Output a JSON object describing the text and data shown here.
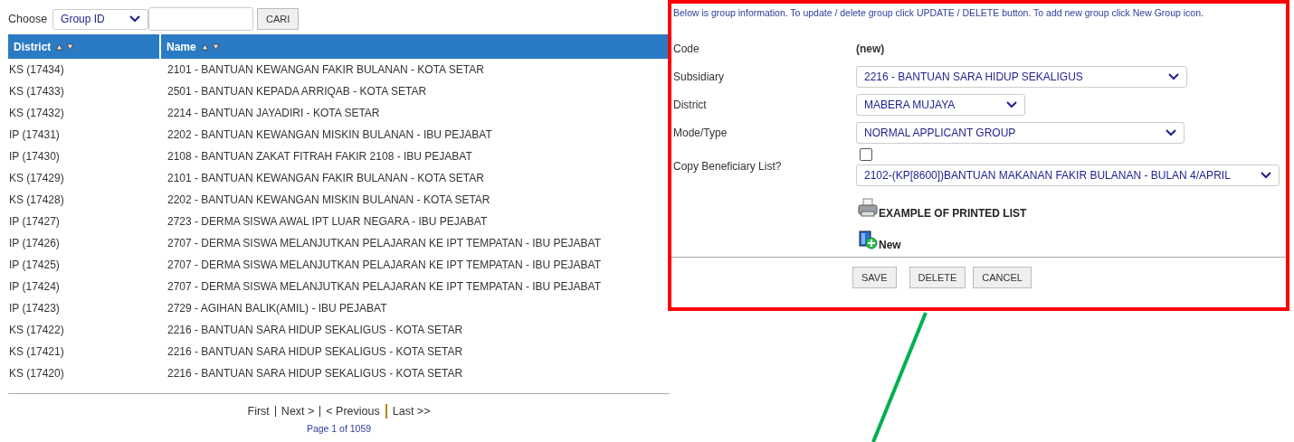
{
  "search": {
    "label": "Choose",
    "field": "Group ID",
    "button": "CARI"
  },
  "table": {
    "columns": [
      "District",
      "Name"
    ],
    "rows": [
      [
        "KS (17434)",
        "2101 - BANTUAN KEWANGAN FAKIR BULANAN - KOTA SETAR"
      ],
      [
        "KS (17433)",
        "2501 - BANTUAN KEPADA ARRIQAB - KOTA SETAR"
      ],
      [
        "KS (17432)",
        "2214 - BANTUAN JAYADIRI - KOTA SETAR"
      ],
      [
        "IP (17431)",
        "2202 - BANTUAN KEWANGAN MISKIN BULANAN - IBU PEJABAT"
      ],
      [
        "IP (17430)",
        "2108 - BANTUAN ZAKAT FITRAH FAKIR 2108 - IBU PEJABAT"
      ],
      [
        "KS (17429)",
        "2101 - BANTUAN KEWANGAN FAKIR BULANAN - KOTA SETAR"
      ],
      [
        "KS (17428)",
        "2202 - BANTUAN KEWANGAN MISKIN BULANAN - KOTA SETAR"
      ],
      [
        "IP (17427)",
        "2723 - DERMA SISWA AWAL IPT LUAR NEGARA - IBU PEJABAT"
      ],
      [
        "IP (17426)",
        "2707 - DERMA SISWA MELANJUTKAN PELAJARAN KE IPT TEMPATAN - IBU PEJABAT"
      ],
      [
        "IP (17425)",
        "2707 - DERMA SISWA MELANJUTKAN PELAJARAN KE IPT TEMPATAN - IBU PEJABAT"
      ],
      [
        "IP (17424)",
        "2707 - DERMA SISWA MELANJUTKAN PELAJARAN KE IPT TEMPATAN - IBU PEJABAT"
      ],
      [
        "IP (17423)",
        "2729 - AGIHAN BALIK(AMIL) - IBU PEJABAT"
      ],
      [
        "KS (17422)",
        "2216 - BANTUAN SARA HIDUP SEKALIGUS - KOTA SETAR"
      ],
      [
        "KS (17421)",
        "2216 - BANTUAN SARA HIDUP SEKALIGUS - KOTA SETAR"
      ],
      [
        "KS (17420)",
        "2216 - BANTUAN SARA HIDUP SEKALIGUS - KOTA SETAR"
      ]
    ]
  },
  "pager": {
    "links": [
      "First",
      "Next >",
      "< Previous",
      "Last >>"
    ],
    "info": "Page 1 of 1059"
  },
  "panel": {
    "intro": "Below is group information. To update / delete group click UPDATE / DELETE button. To add new group click New Group icon.",
    "fields": [
      {
        "label": "Code",
        "kind": "text",
        "value": "(new)"
      },
      {
        "label": "Subsidiary",
        "kind": "select",
        "value": "2216 - BANTUAN SARA HIDUP SEKALIGUS"
      },
      {
        "label": "District",
        "kind": "select",
        "value": "MABERA MUJAYA"
      },
      {
        "label": "Mode/Type",
        "kind": "select",
        "value": "NORMAL APPLICANT GROUP"
      },
      {
        "label": "Copy Beneficiary List?",
        "kind": "checkbox-select",
        "checked": false,
        "value": "2102-(KP[8600])BANTUAN MAKANAN FAKIR BULANAN - BULAN 4/APRIL"
      }
    ],
    "actions": [
      {
        "kind": "print",
        "label": "EXAMPLE OF PRINTED LIST"
      },
      {
        "kind": "new",
        "label": "New"
      }
    ],
    "buttons": [
      "SAVE",
      "DELETE",
      "CANCEL"
    ]
  }
}
